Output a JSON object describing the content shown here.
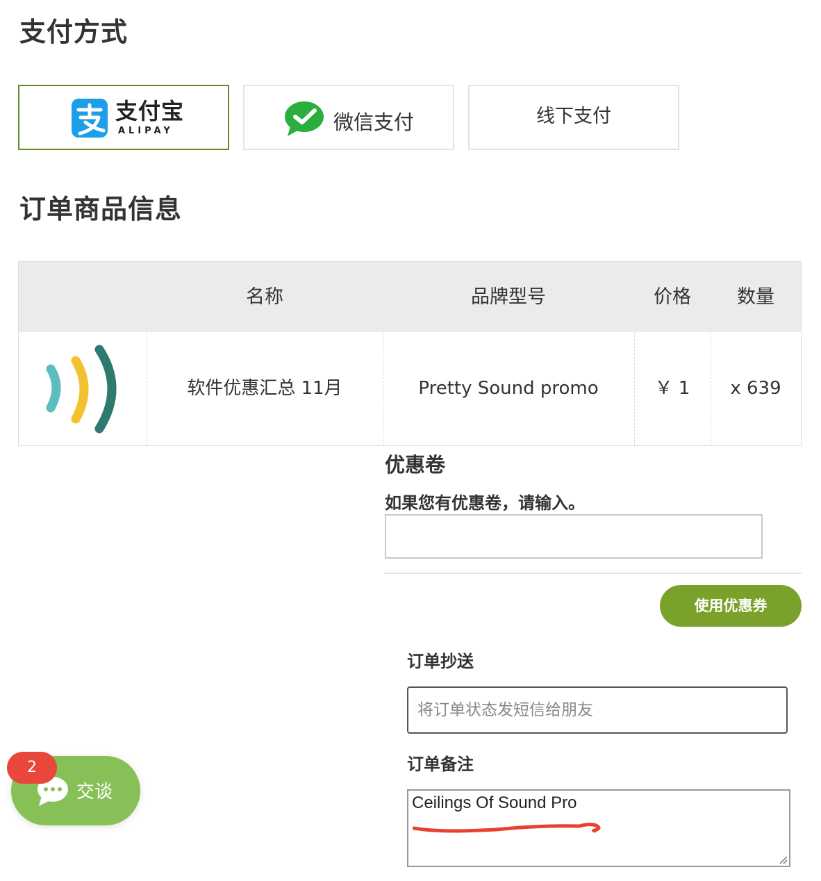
{
  "payment": {
    "title": "支付方式",
    "options": [
      {
        "cn": "支付宝",
        "en": "ALIPAY",
        "selected": true
      },
      {
        "label": "微信支付"
      },
      {
        "label": "线下支付"
      }
    ]
  },
  "order": {
    "title": "订单商品信息",
    "headers": [
      "名称",
      "品牌型号",
      "价格",
      "数量"
    ],
    "row": {
      "name": "软件优惠汇总 11月",
      "model": "Pretty Sound promo",
      "price": "￥ 1",
      "qty": "x 639"
    }
  },
  "coupon": {
    "title": "优惠卷",
    "hint": "如果您有优惠卷，请输入。",
    "value": "",
    "button": "使用优惠券"
  },
  "cc": {
    "title": "订单抄送",
    "placeholder": "将订单状态发短信给朋友"
  },
  "note": {
    "title": "订单备注",
    "value": "Ceilings Of Sound Pro"
  },
  "chat": {
    "label": "交谈",
    "badge": "2"
  },
  "colors": {
    "selected_border": "#5f8a27",
    "coupon_button": "#7aa22a",
    "chat_bg": "#88c058",
    "badge": "#e9473b",
    "note_underline": "#e8412f"
  }
}
